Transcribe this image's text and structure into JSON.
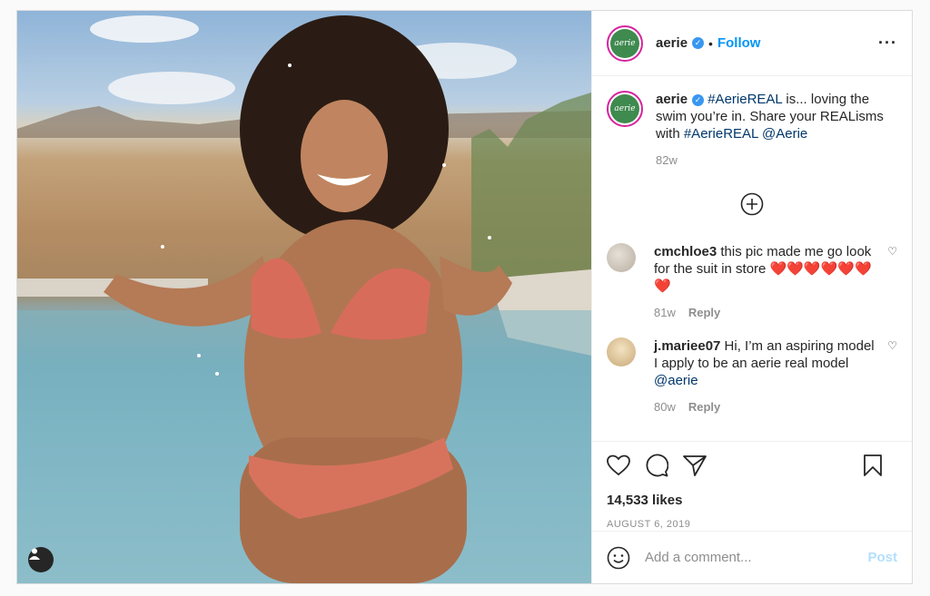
{
  "header": {
    "username": "aerie",
    "avatar_text": "aerie",
    "separator": "•",
    "follow_label": "Follow",
    "more_icon": "more-horizontal-icon"
  },
  "caption": {
    "username": "aerie",
    "text_prefix": " ",
    "hashtag1": "#AerieREAL",
    "text_mid": " is... loving the swim you’re in. Share your REALisms with ",
    "hashtag2": "#AerieREAL",
    "text_space": " ",
    "mention": "@Aerie",
    "time": "82w"
  },
  "comments": [
    {
      "username": "cmchloe3",
      "text": " this pic made me go look for the suit in store ❤️❤️❤️❤️❤️❤️❤️",
      "time": "81w",
      "reply_label": "Reply"
    },
    {
      "username": "j.mariee07",
      "text": " Hi, I’m an aspiring model I apply to be an aerie real model ",
      "mention": "@aerie",
      "time": "80w",
      "reply_label": "Reply"
    }
  ],
  "likes": "14,533 likes",
  "date": "AUGUST 6, 2019",
  "add_comment": {
    "placeholder": "Add a comment...",
    "post_label": "Post"
  },
  "colors": {
    "accent": "#0095f6",
    "avatar_green": "#3f8a4f",
    "post_disabled": "#b2dffc"
  }
}
